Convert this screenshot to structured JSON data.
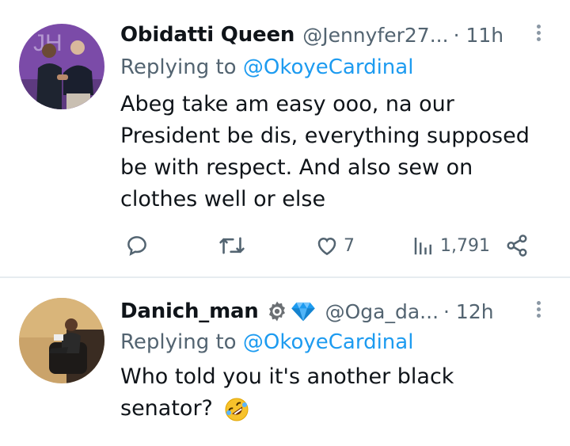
{
  "tweets": [
    {
      "name": "Obidatti Queen",
      "handle": "@Jennyfer27...",
      "time": "· 11h",
      "replying_prefix": "Replying to",
      "replying_to": "@OkoyeCardinal",
      "text": "Abeg take am easy ooo, na our President be dis, everything supposed be with respect.  And also sew on clothes well or else",
      "actions": {
        "reply": "",
        "retweet": "",
        "likes": "7",
        "views": "1,791"
      }
    },
    {
      "name": "Danich_man",
      "badges": [
        "gear-icon",
        "gem-icon"
      ],
      "handle": "@Oga_da...",
      "time": "· 12h",
      "replying_prefix": "Replying to",
      "replying_to": "@OkoyeCardinal",
      "text": "Who told you it's another black senator?",
      "emoji": "rolling-laughing-emoji"
    }
  ],
  "colors": {
    "text": "#0f1419",
    "muted": "#536471",
    "link": "#1d9bf0",
    "divider": "#e6ecf0",
    "gem": "#1d9bf0"
  }
}
